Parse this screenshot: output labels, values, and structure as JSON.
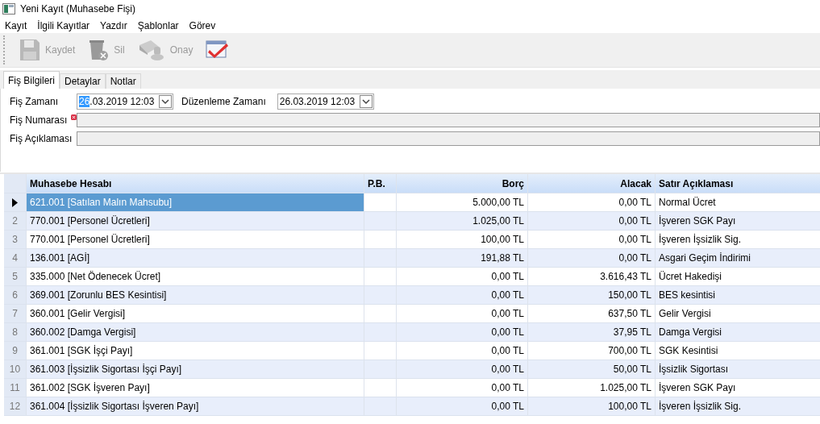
{
  "window": {
    "title": "Yeni Kayıt (Muhasebe Fişi)"
  },
  "menu": [
    "Kayıt",
    "İlgili Kayıtlar",
    "Yazdır",
    "Şablonlar",
    "Görev"
  ],
  "toolbar": [
    {
      "kind": "save",
      "label": "Kaydet",
      "disabled": true
    },
    {
      "kind": "delete",
      "label": "Sil",
      "disabled": true
    },
    {
      "kind": "approve",
      "label": "Onay",
      "disabled": true
    },
    {
      "kind": "check",
      "disabled": false
    }
  ],
  "tabs": [
    {
      "label": "Fiş Bilgileri",
      "selected": true
    },
    {
      "label": "Detaylar",
      "selected": false
    },
    {
      "label": "Notlar",
      "selected": false
    }
  ],
  "form": {
    "fis_zamani": {
      "label": "Fiş Zamanı",
      "value_selected": "26",
      "value_rest": ".03.2019 12:03"
    },
    "duzenleme_zamani": {
      "label": "Düzenleme Zamanı",
      "value": "26.03.2019 12:03"
    },
    "fis_numarasi": {
      "label": "Fiş Numarası",
      "required_error": true
    },
    "fis_aciklamasi": {
      "label": "Fiş Açıklaması"
    }
  },
  "table": {
    "columns": [
      "Muhasebe Hesabı",
      "P.B.",
      "Borç",
      "Alacak",
      "Satır Açıklaması"
    ],
    "rows": [
      {
        "selected": true,
        "hesap": "621.001 [Satılan Malın Mahsubu]",
        "borc": "5.000,00 TL",
        "alacak": "0,00 TL",
        "aciklama": "Normal Ücret"
      },
      {
        "selected": false,
        "number": "2",
        "hesap": "770.001 [Personel Ücretleri]",
        "borc": "1.025,00 TL",
        "alacak": "0,00 TL",
        "aciklama": "İşveren SGK Payı"
      },
      {
        "selected": false,
        "number": "3",
        "hesap": "770.001 [Personel Ücretleri]",
        "borc": "100,00 TL",
        "alacak": "0,00 TL",
        "aciklama": "İşveren İşsizlik Sig."
      },
      {
        "selected": false,
        "number": "4",
        "hesap": "136.001 [AGİ]",
        "borc": "191,88 TL",
        "alacak": "0,00 TL",
        "aciklama": "Asgari Geçim İndirimi"
      },
      {
        "selected": false,
        "number": "5",
        "hesap": "335.000 [Net Ödenecek Ücret]",
        "borc": "0,00 TL",
        "alacak": "3.616,43 TL",
        "aciklama": "Ücret Hakedişi"
      },
      {
        "selected": false,
        "number": "6",
        "hesap": "369.001 [Zorunlu BES Kesintisi]",
        "borc": "0,00 TL",
        "alacak": "150,00 TL",
        "aciklama": "BES kesintisi"
      },
      {
        "selected": false,
        "number": "7",
        "hesap": "360.001 [Gelir Vergisi]",
        "borc": "0,00 TL",
        "alacak": "637,50 TL",
        "aciklama": "Gelir Vergisi"
      },
      {
        "selected": false,
        "number": "8",
        "hesap": "360.002 [Damga Vergisi]",
        "borc": "0,00 TL",
        "alacak": "37,95 TL",
        "aciklama": "Damga Vergisi"
      },
      {
        "selected": false,
        "number": "9",
        "hesap": "361.001 [SGK İşçi Payı]",
        "borc": "0,00 TL",
        "alacak": "700,00 TL",
        "aciklama": "SGK Kesintisi"
      },
      {
        "selected": false,
        "number": "10",
        "hesap": "361.003 [İşsizlik Sigortası İşçi Payı]",
        "borc": "0,00 TL",
        "alacak": "50,00 TL",
        "aciklama": "İşsizlik Sigortası"
      },
      {
        "selected": false,
        "number": "11",
        "hesap": "361.002 [SGK İşveren Payı]",
        "borc": "0,00 TL",
        "alacak": "1.025,00 TL",
        "aciklama": "İşveren SGK Payı"
      },
      {
        "selected": false,
        "number": "12",
        "hesap": "361.004 [İşsizlik Sigortası İşveren Payı]",
        "borc": "0,00 TL",
        "alacak": "100,00 TL",
        "aciklama": "İşveren İşsizlik Sig."
      }
    ]
  }
}
